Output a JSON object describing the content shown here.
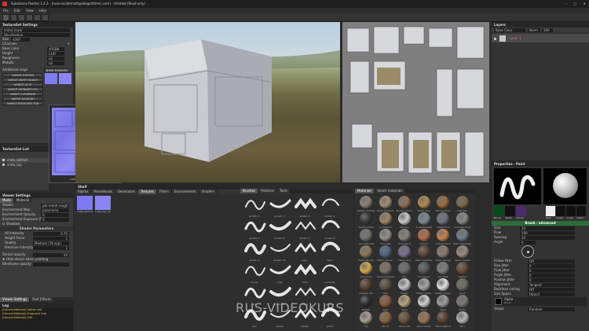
{
  "window": {
    "title": "Substance Painter 1.4.2 - [ruse.mcdermott@allegorithmic.com] - Untitled (Read only)"
  },
  "menu": [
    "File",
    "Edit",
    "View",
    "Help"
  ],
  "texset": {
    "title": "TextureSet Settings",
    "set_name": "initial shadi",
    "shader_label": "Sbustitution",
    "size_label": "Size",
    "size_value": "4097",
    "channels_label": "Channels",
    "channels": [
      {
        "name": "Base Color",
        "value": "sRGB8"
      },
      {
        "name": "Height",
        "value": "L16F"
      },
      {
        "name": "Roughness",
        "value": "L8"
      },
      {
        "name": "Metallic",
        "value": "L8"
      }
    ],
    "additional_maps_label": "Additional maps",
    "bake_button": "Bake textures",
    "select_buttons": [
      "Select normal",
      "Select world space",
      "Select id m",
      "Select ambient occ",
      "Select curvature",
      "Select position",
      "Select thickness ma"
    ],
    "thumb_caption": "crate_textured_normal"
  },
  "texlist": {
    "title": "TextureSet List",
    "items": [
      "crate_bottom",
      "crate_top"
    ]
  },
  "viewer": {
    "title": "Viewer Settings",
    "tabs": [
      "Mode",
      "Material"
    ],
    "rows": [
      {
        "label": "Shader",
        "value": "pbr-metal-rough"
      },
      {
        "label": "Environment Map",
        "value": "panorama"
      },
      {
        "label": "Environment Opacity",
        "value": "0"
      },
      {
        "label": "Environment Exposure (EV)",
        "value": "0"
      },
      {
        "label": "Shadows",
        "value": ""
      }
    ],
    "section": "Shader Parameters",
    "params": [
      {
        "label": "AO Intensity",
        "value": "0.75"
      },
      {
        "label": "Height Force",
        "value": "1"
      },
      {
        "label": "Quality",
        "value": "Medium (16 spp)"
      },
      {
        "label": "Emissive Intensity",
        "value": "1"
      }
    ],
    "stencil_label": "Stencil opacity",
    "stencil_value": "20",
    "hide_label": "Hide stencil when painting",
    "wireframe_label": "Wireframe opacity",
    "bottom_tabs": [
      "Viewer Settings",
      "Post Effects"
    ]
  },
  "log": {
    "title": "Log",
    "lines": [
      "[GenericMaterial] Vertex info",
      "[GenericMaterial] Fragment info",
      "[GenericMaterial] Info"
    ]
  },
  "shelf": {
    "title": "Shelf",
    "tabs": [
      "Alphas",
      "Procedurals",
      "Generators",
      "Textures",
      "Filters",
      "Environments",
      "Shaders"
    ],
    "active_tab": "Textures",
    "textures": [
      {
        "label": "crate_textured_normal"
      },
      {
        "label": "crate_top_normal"
      }
    ],
    "search": "Search"
  },
  "brushes": {
    "tabs": [
      "Brushes",
      "Particles",
      "Tools"
    ],
    "items": [
      "artistic 1",
      "artistic 2",
      "artistic 3",
      "artistic 4",
      "artistic 5",
      "artistic 6",
      "artistic 7",
      "artistic 8",
      "artistic 9",
      "artistic 10",
      "basic",
      "bark",
      "bones",
      "chalk",
      "cloth",
      "concrete",
      "dirt",
      "dry brush",
      "fibers",
      "grunge",
      "hair",
      "leaves",
      "marker",
      "paint"
    ]
  },
  "materials": {
    "tabs": [
      "Materials",
      "Smart materials"
    ],
    "items": [
      "Baked Lighting",
      "Bone Stylized",
      "Bronze Armor",
      "Brass Pure",
      "Bronze Pure",
      "Calf Skin",
      "Carbon Fiber",
      "Cardboard",
      "Chrome",
      "Coated Metal",
      "Cobalt Pure",
      "Concrete Dirty",
      "Concrete Old",
      "Concrete",
      "Concrete 2",
      "Copper",
      "Copper Pure",
      "Fabric Baseball",
      "Fabric Burlap",
      "Fabric Denim",
      "Fabric Knit",
      "Fabric Leather",
      "Fabric Rough",
      "Fabric Suede",
      "Gold Pure",
      "Ground Gravel",
      "Iron",
      "Iron Forge",
      "Iron Raw",
      "Leather",
      "Leather Old",
      "Mud",
      "Plastic",
      "Plastic Matte",
      "Plastic Glossy",
      "Rock",
      "Rubber",
      "Rust",
      "Sand",
      "Silver",
      "Steel",
      "Stone",
      "Tile",
      "Wood",
      "Wood Old",
      "Wood Plank",
      "Wood Walnut",
      "Zinc"
    ],
    "colors": [
      "#8a8075",
      "#a28d70",
      "#8f6e52",
      "#b28b4f",
      "#9c6b3a",
      "#7e6650",
      "#3a3a3a",
      "#a0845f",
      "#c9c9c9",
      "#7d8a94",
      "#6b7480",
      "#8a8a84",
      "#74746e",
      "#93918a",
      "#85837c",
      "#b56b48",
      "#c7804f",
      "#6f7c8d",
      "#8b7558",
      "#4f6584",
      "#7a6d8e",
      "#5d4536",
      "#8a7e6f",
      "#9a8a78",
      "#d1a746",
      "#7b7164",
      "#6b6b6b",
      "#595959",
      "#7c7c7c",
      "#6a4a36",
      "#5a4131",
      "#5e5140",
      "#c4c4c4",
      "#a7a7a7",
      "#e0e0e0",
      "#6f6a62",
      "#2f2f2f",
      "#8c5a3a",
      "#b6a17b",
      "#cfcfcf",
      "#9d9d9d",
      "#7b7873",
      "#a89e8e",
      "#8a6442",
      "#6c5038",
      "#9a7552",
      "#5b4130",
      "#b4b4b4"
    ]
  },
  "layers": {
    "title": "Layers",
    "blend": "Base Color",
    "mode": "Norm",
    "opacity": "100",
    "items": [
      "Layer 1"
    ]
  },
  "properties": {
    "title": "Properties - Paint",
    "thumbs": [
      "Brush",
      "Alpha",
      "Stencil"
    ],
    "material_chips": [
      "base",
      "height",
      "rough",
      "metal"
    ],
    "section": "Brush - advanced",
    "rows": [
      {
        "label": "Size",
        "value": "10"
      },
      {
        "label": "Flow",
        "value": "100"
      },
      {
        "label": "Spacing",
        "value": "20"
      },
      {
        "label": "Angle",
        "value": "0"
      }
    ],
    "rows2": [
      {
        "label": "Follow Path",
        "value": "Off"
      },
      {
        "label": "Size Jitter",
        "value": "0"
      },
      {
        "label": "Flow Jitter",
        "value": "0"
      },
      {
        "label": "Angle Jitter",
        "value": "0"
      },
      {
        "label": "Position Jitter",
        "value": "0"
      },
      {
        "label": "Alignment",
        "value": "Tangent"
      },
      {
        "label": "Backface culling",
        "value": "Off"
      },
      {
        "label": "Size Space",
        "value": "Object"
      }
    ],
    "alpha_label": "Alpha",
    "alpha_sub": "Brush",
    "shape_label": "Shape",
    "shape_value": "Random"
  },
  "watermark": "RUS-VIDEOKURS",
  "colors": {
    "accent": "#6a8fbf",
    "active_tab": "#555555",
    "panel_bg": "#3a3a3a",
    "header_bg": "#262626"
  }
}
